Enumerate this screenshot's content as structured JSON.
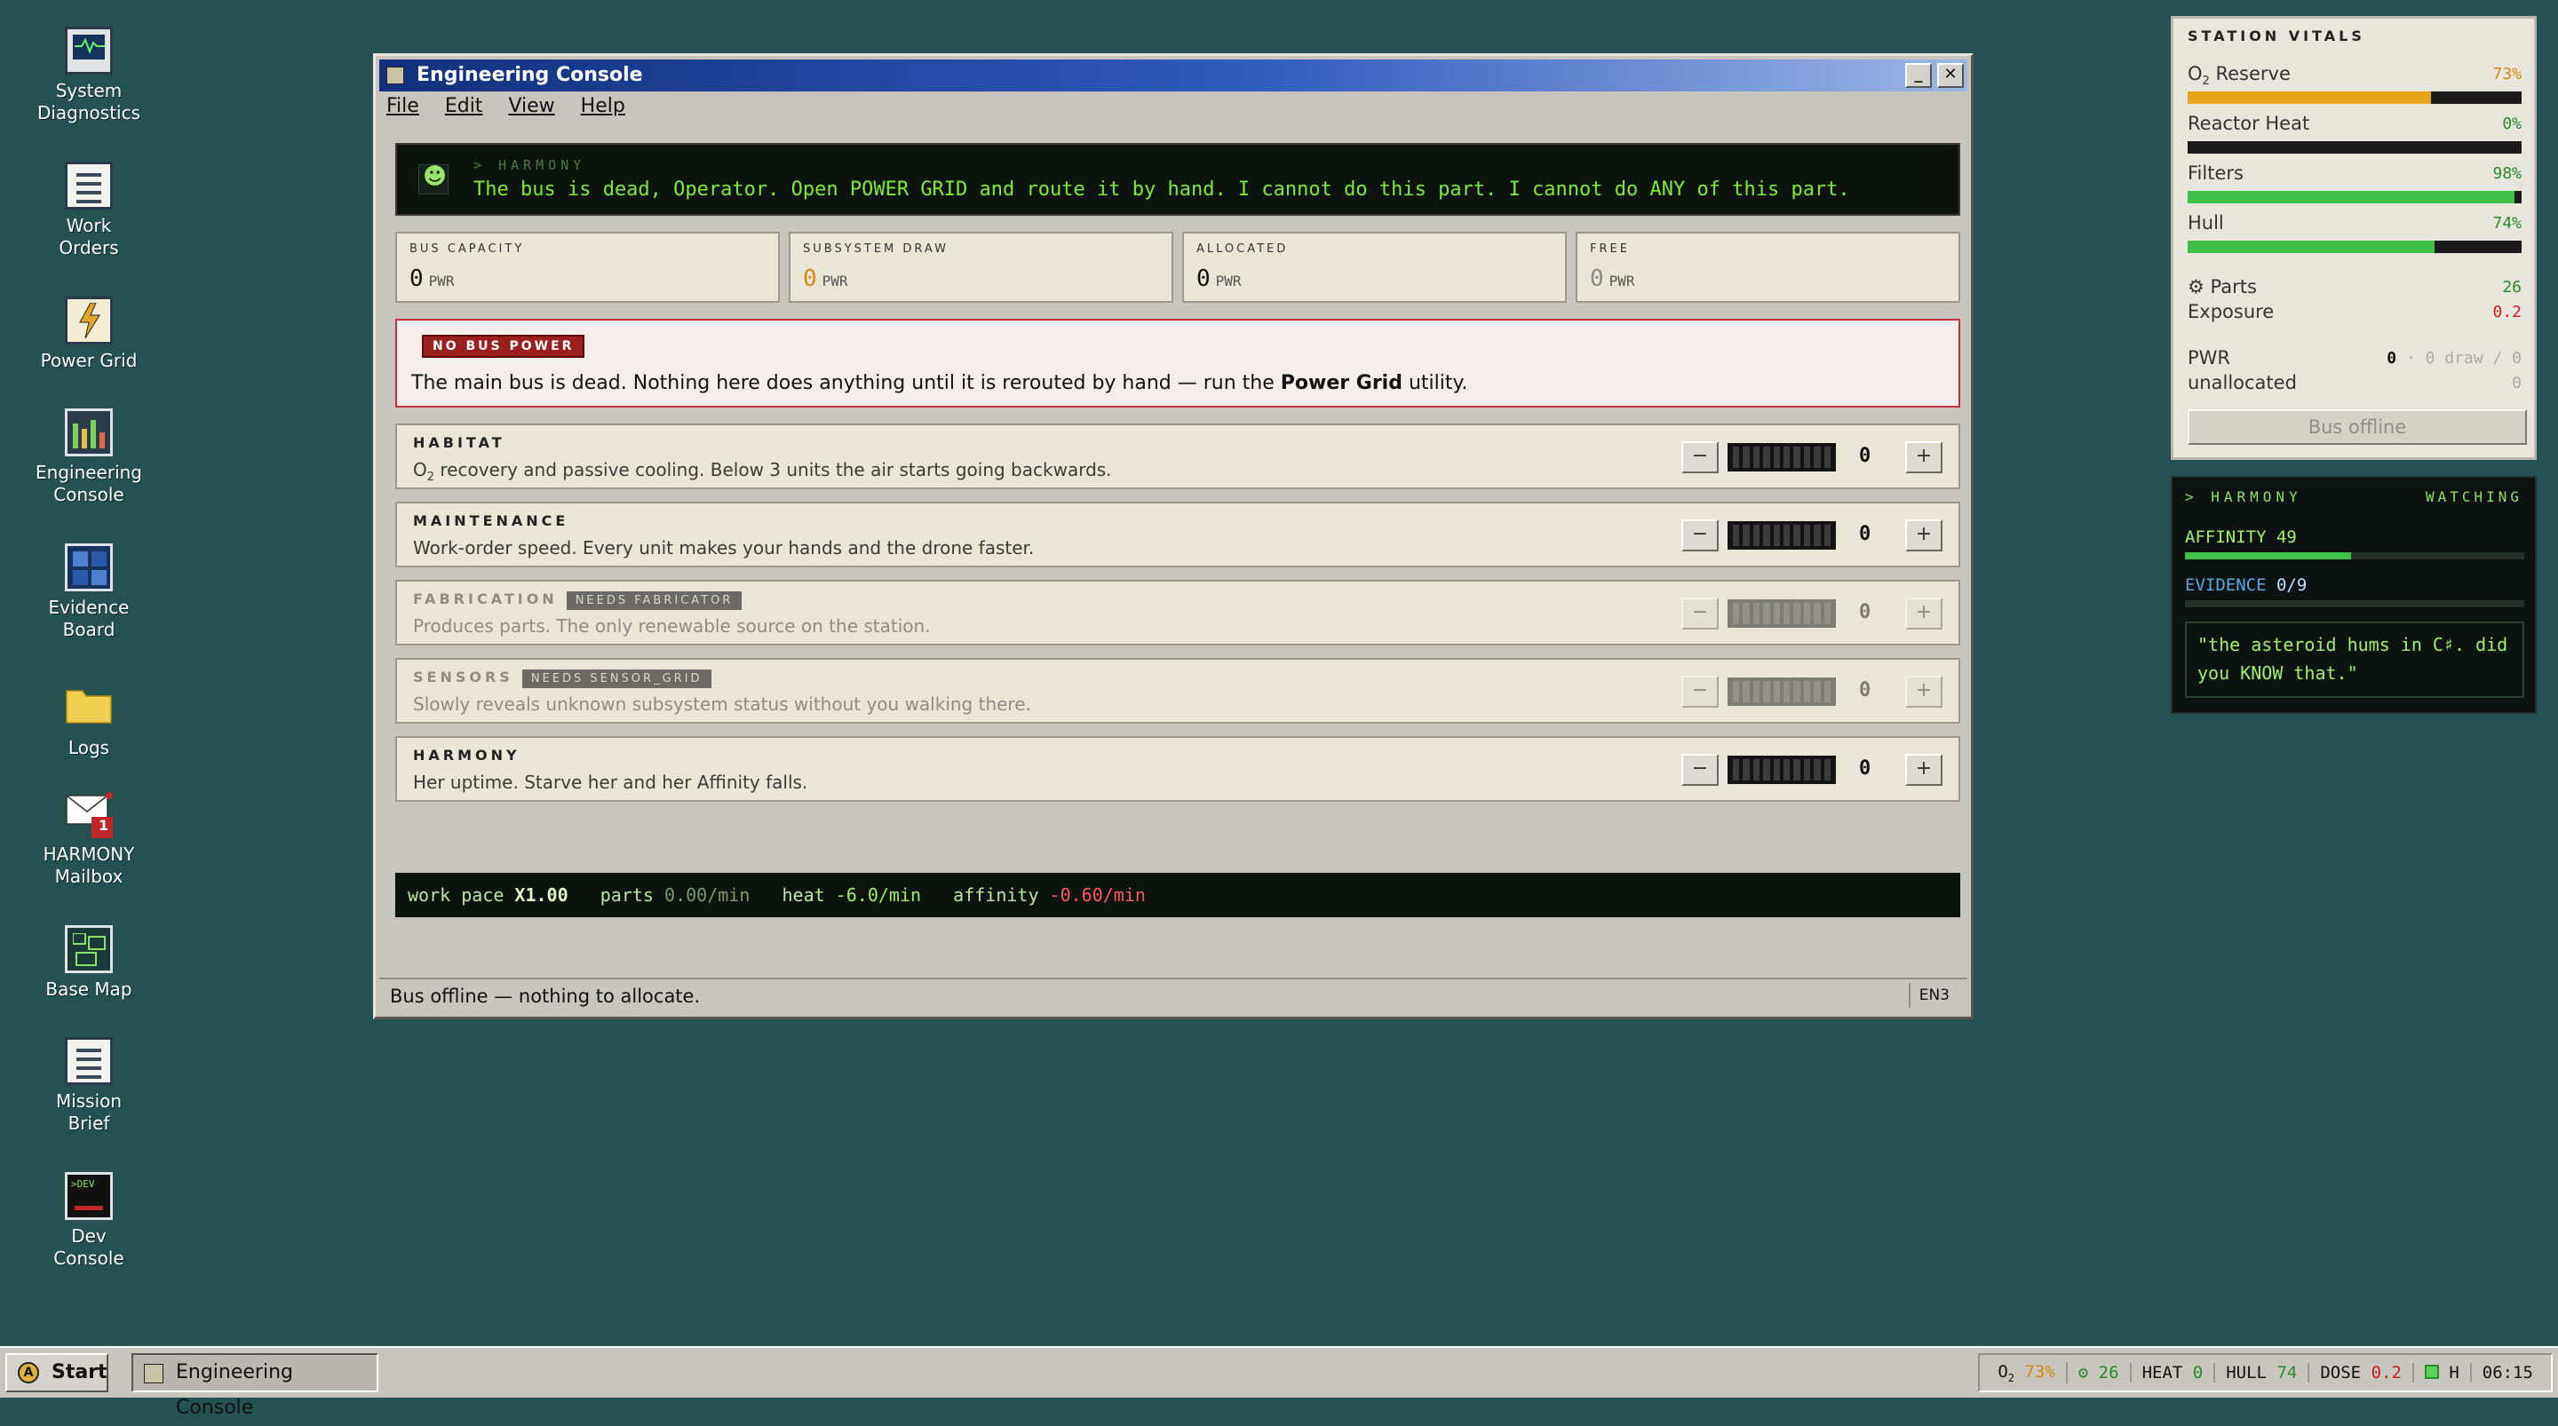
{
  "desktop": {
    "icons": [
      {
        "label": "System\nDiagnostics",
        "icon": "monitor-icon"
      },
      {
        "label": "Work\nOrders",
        "icon": "document-icon"
      },
      {
        "label": "Power Grid",
        "icon": "power-grid-icon"
      },
      {
        "label": "Engineering\nConsole",
        "icon": "console-icon"
      },
      {
        "label": "Evidence\nBoard",
        "icon": "board-icon"
      },
      {
        "label": "Logs",
        "icon": "folder-icon"
      },
      {
        "label": "HARMONY\nMailbox",
        "icon": "mail-icon"
      },
      {
        "label": "Base Map",
        "icon": "map-icon"
      },
      {
        "label": "Mission\nBrief",
        "icon": "document-icon"
      },
      {
        "label": "Dev\nConsole",
        "icon": "terminal-icon"
      }
    ],
    "mail_badge": "1",
    "dev_icon_text": ">DEV"
  },
  "window": {
    "title": "Engineering Console",
    "menu": [
      "File",
      "Edit",
      "View",
      "Help"
    ],
    "harmony": {
      "label": "> HARMONY",
      "message": "The bus is dead, Operator. Open POWER GRID and route it by hand. I cannot do this part. I cannot do ANY of this part."
    },
    "stats": [
      {
        "label": "BUS CAPACITY",
        "value": "0",
        "unit": "PWR"
      },
      {
        "label": "SUBSYSTEM DRAW",
        "value": "0",
        "unit": "PWR"
      },
      {
        "label": "ALLOCATED",
        "value": "0",
        "unit": "PWR"
      },
      {
        "label": "FREE",
        "value": "0",
        "unit": "PWR"
      }
    ],
    "alert": {
      "badge": "NO BUS POWER",
      "text_before": "The main bus is dead. Nothing here does anything until it is rerouted by hand — run the ",
      "text_bold": "Power Grid",
      "text_after": " utility."
    },
    "subsystems": [
      {
        "name": "HABITAT",
        "tag": "",
        "desc_prefix": "O",
        "desc_sub": "2",
        "desc": " recovery and passive cooling. Below 3 units the air starts going backwards.",
        "value": "0",
        "dim": false
      },
      {
        "name": "MAINTENANCE",
        "tag": "",
        "desc_prefix": "",
        "desc_sub": "",
        "desc": "Work-order speed. Every unit makes your hands and the drone faster.",
        "value": "0",
        "dim": false
      },
      {
        "name": "FABRICATION",
        "tag": "NEEDS FABRICATOR",
        "desc_prefix": "",
        "desc_sub": "",
        "desc": "Produces parts. The only renewable source on the station.",
        "value": "0",
        "dim": true
      },
      {
        "name": "SENSORS",
        "tag": "NEEDS SENSOR_GRID",
        "desc_prefix": "",
        "desc_sub": "",
        "desc": "Slowly reveals unknown subsystem status without you walking there.",
        "value": "0",
        "dim": true
      },
      {
        "name": "HARMONY",
        "tag": "",
        "desc_prefix": "",
        "desc_sub": "",
        "desc": "Her uptime. Starve her and her Affinity falls.",
        "value": "0",
        "dim": false
      }
    ],
    "controls": {
      "minus": "−",
      "plus": "+"
    },
    "pace": {
      "work_label": "work pace",
      "work_value": "X1.00",
      "parts_label": "parts",
      "parts_value": "0.00/min",
      "heat_label": "heat",
      "heat_value": "-6.0/min",
      "affinity_label": "affinity",
      "affinity_value": "-0.60/min"
    },
    "status": "Bus offline — nothing to allocate.",
    "status_right": "EN3"
  },
  "vitals": {
    "title": "STATION VITALS",
    "o2_label_prefix": "O",
    "o2_label_sub": "2",
    "o2_label_rest": " Reserve",
    "o2_value": "73%",
    "o2_fraction": 0.73,
    "reactor_label": "Reactor Heat",
    "reactor_value": "0%",
    "reactor_fraction": 0.0,
    "filters_label": "Filters",
    "filters_value": "98%",
    "filters_fraction": 0.98,
    "hull_label": "Hull",
    "hull_value": "74%",
    "hull_fraction": 0.74,
    "parts_label": "⚙ Parts",
    "parts_value": "26",
    "exposure_label": "Exposure",
    "exposure_value": "0.2",
    "pwr_label": "PWR",
    "pwr_value_main": "0",
    "pwr_value_rest": " · 0 draw / 0",
    "unallocated_label": "unallocated",
    "unallocated_value": "0",
    "button": "Bus offline",
    "colors": {
      "o2": "#e8a51c",
      "filters": "#3fbf4a",
      "hull": "#3fbf4a"
    }
  },
  "harmony_panel": {
    "label": "> HARMONY",
    "state": "WATCHING",
    "affinity_label": "AFFINITY 49",
    "affinity_fraction": 0.49,
    "evidence_label": "EVIDENCE",
    "evidence_value": "0/9",
    "quote": "\"the asteroid hums in C♯. did you KNOW that.\""
  },
  "taskbar": {
    "start": "Start",
    "task": "Engineering Console",
    "tray": {
      "o2_prefix": "O",
      "o2_sub": "2",
      "o2_value": "73%",
      "parts_value": "⚙ 26",
      "heat_label": "HEAT",
      "heat_value": "0",
      "hull_label": "HULL",
      "hull_value": "74",
      "dose_label": "DOSE",
      "dose_value": "0.2",
      "h_label": "H",
      "clock": "06:15"
    }
  }
}
